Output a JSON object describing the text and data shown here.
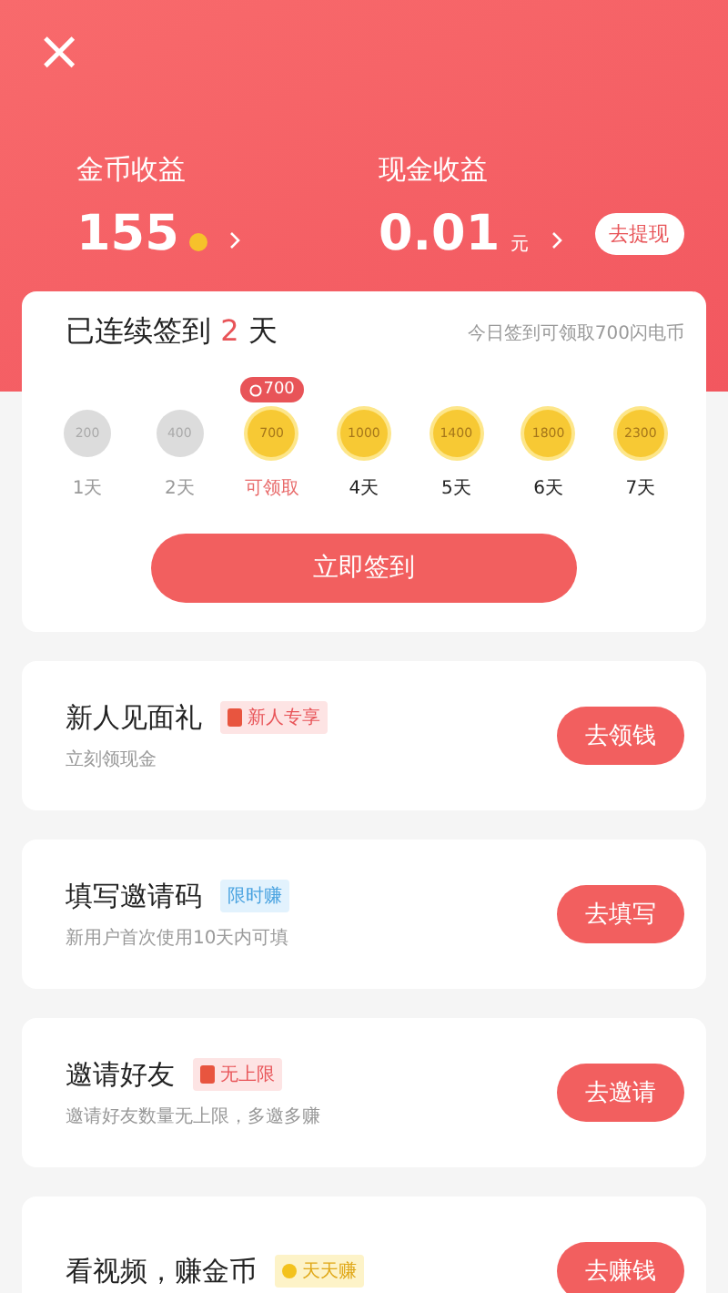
{
  "header": {
    "close": "×",
    "coins": {
      "label": "金币收益",
      "value": "155"
    },
    "cash": {
      "label": "现金收益",
      "value": "0.01",
      "unit": "元",
      "button": "去提现"
    }
  },
  "checkin": {
    "title_prefix": "已连续签到",
    "streak": "2",
    "title_suffix": "天",
    "hint": "今日签到可领取700闪电币",
    "tooltip": "700",
    "days": [
      {
        "amount": "200",
        "label": "1天",
        "claimed": true,
        "available": false
      },
      {
        "amount": "400",
        "label": "2天",
        "claimed": true,
        "available": false
      },
      {
        "amount": "700",
        "label": "可领取",
        "claimed": false,
        "available": true
      },
      {
        "amount": "1000",
        "label": "4天",
        "claimed": false,
        "available": false
      },
      {
        "amount": "1400",
        "label": "5天",
        "claimed": false,
        "available": false
      },
      {
        "amount": "1800",
        "label": "6天",
        "claimed": false,
        "available": false
      },
      {
        "amount": "2300",
        "label": "7天",
        "claimed": false,
        "available": false
      }
    ],
    "button": "立即签到"
  },
  "tasks": [
    {
      "title": "新人见面礼",
      "tag": {
        "text": "新人专享",
        "kind": "red"
      },
      "subtitle": "立刻领现金",
      "button": "去领钱"
    },
    {
      "title": "填写邀请码",
      "tag": {
        "text": "限时赚",
        "kind": "blue"
      },
      "subtitle": "新用户首次使用10天内可填",
      "button": "去填写"
    },
    {
      "title": "邀请好友",
      "tag": {
        "text": "无上限",
        "kind": "red"
      },
      "subtitle": "邀请好友数量无上限，多邀多赚",
      "button": "去邀请"
    },
    {
      "title": "看视频，赚金币",
      "tag": {
        "text": "天天赚",
        "kind": "yellow"
      },
      "button": "去赚钱"
    }
  ]
}
